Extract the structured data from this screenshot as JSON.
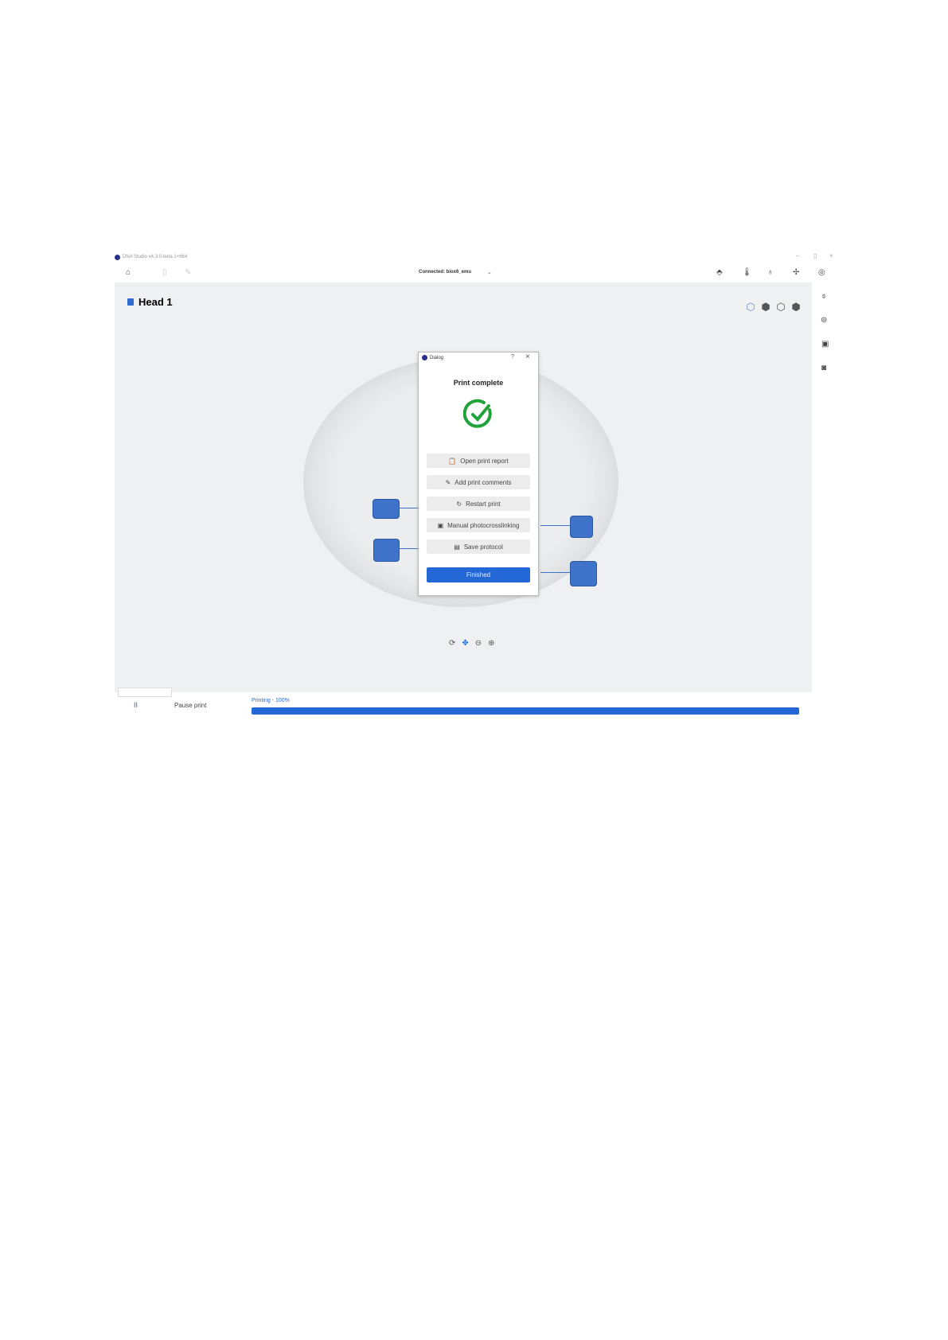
{
  "window": {
    "title": "DNA Studio v4.3.0-beta.1+664",
    "connection": "Connected: biox6_emu",
    "min": "–",
    "max": "▯",
    "close": "×"
  },
  "toolbar": {
    "icons": [
      "home-icon",
      "layers-icon",
      "edit-icon"
    ],
    "right_icons": [
      "nozzle-icon",
      "thermometer-icon",
      "light-icon",
      "fan-icon",
      "camera-icon"
    ]
  },
  "main": {
    "head_label": "Head 1",
    "accent": "#2e6cd1"
  },
  "dialog": {
    "title": "Dialog",
    "help": "?",
    "close": "×",
    "heading": "Print complete",
    "check_color": "#22a33a",
    "buttons": [
      {
        "icon": "report-icon",
        "glyph": "📋",
        "label": "Open print report"
      },
      {
        "icon": "comment-icon",
        "glyph": "✎",
        "label": "Add print comments"
      },
      {
        "icon": "restart-icon",
        "glyph": "↻",
        "label": "Restart print"
      },
      {
        "icon": "photocrosslink-icon",
        "glyph": "▣",
        "label": "Manual photocrosslinking"
      },
      {
        "icon": "save-icon",
        "glyph": "▤",
        "label": "Save protocol"
      }
    ],
    "finish": "Finished"
  },
  "bottom": {
    "pause_icon": "II",
    "pause_label": "Pause print",
    "progress_label": "Printing - 100%",
    "progress": 100
  }
}
